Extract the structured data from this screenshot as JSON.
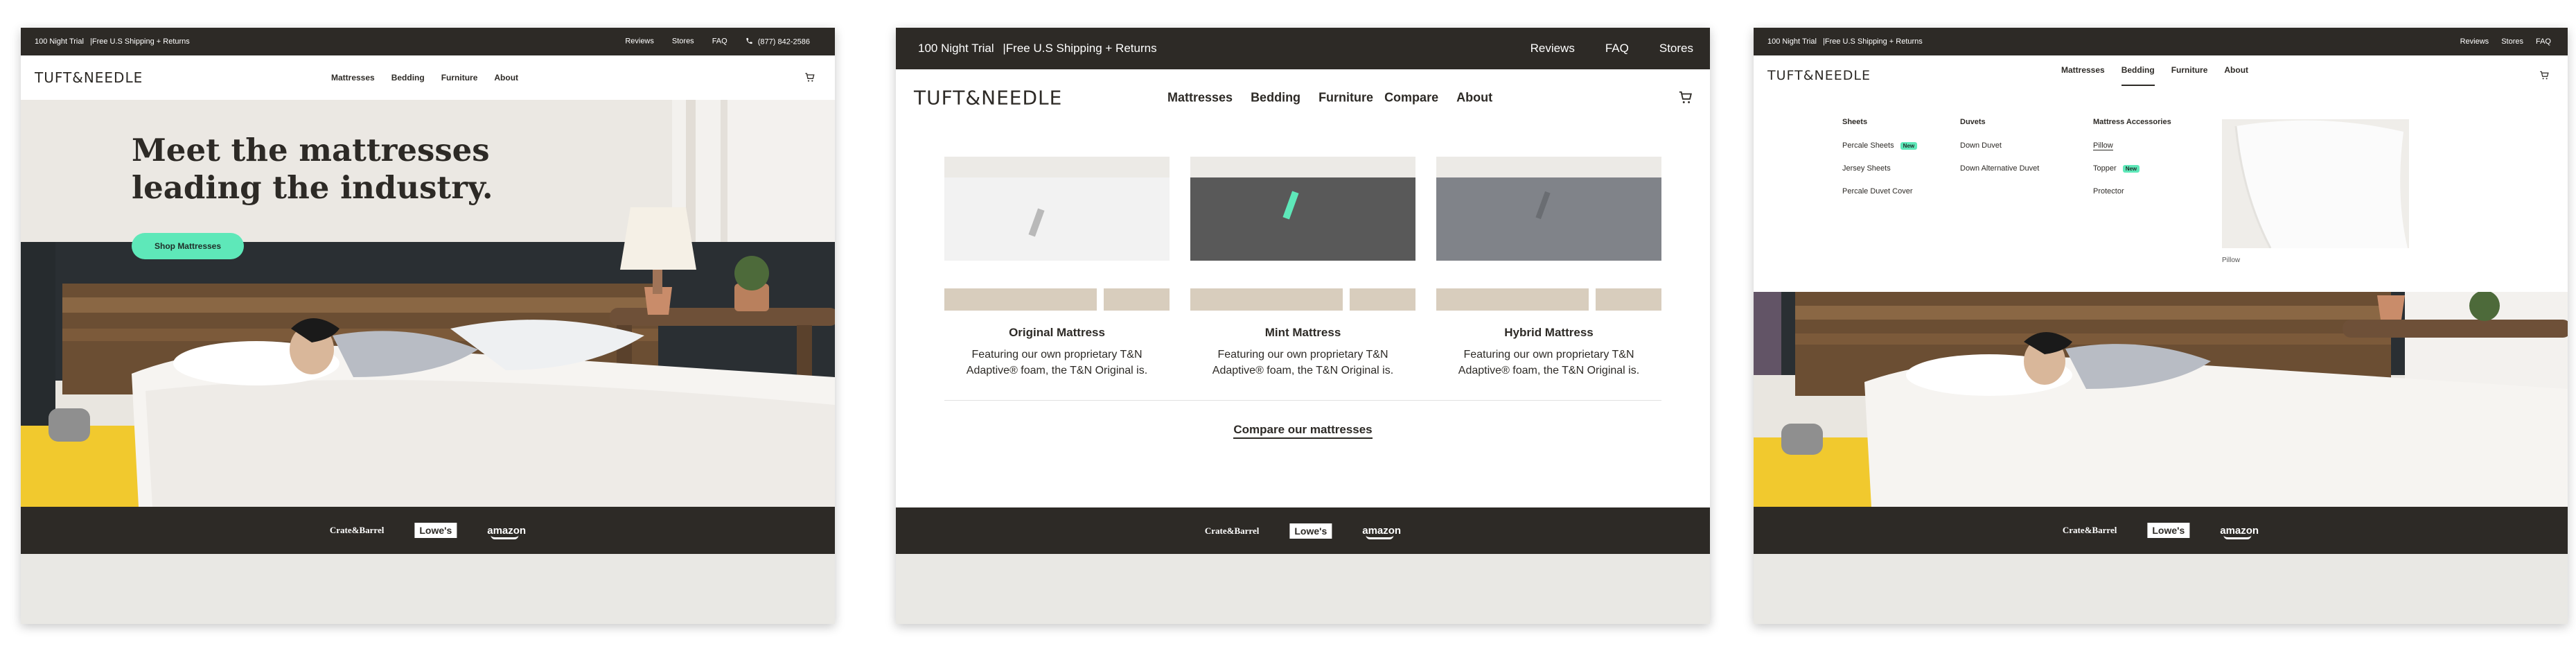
{
  "topbar": {
    "trial": "100 Night Trial",
    "shipping": "|Free U.S Shipping + Returns",
    "links": [
      "Reviews",
      "Stores",
      "FAQ"
    ],
    "phone": "(877) 842-2586",
    "links_alt": [
      "Reviews",
      "FAQ",
      "Stores"
    ],
    "links_right": [
      "Reviews",
      "Stores",
      "FAQ"
    ]
  },
  "nav": {
    "logo": "TUFT&NEEDLE",
    "items": [
      "Mattresses",
      "Bedding",
      "Furniture",
      "About"
    ],
    "items_with_compare": [
      "Mattresses",
      "Bedding",
      "Furniture",
      "Compare",
      "About"
    ]
  },
  "hero": {
    "headline_line1": "Meet the mattresses",
    "headline_line2": "leading the industry.",
    "cta": "Shop Mattresses"
  },
  "retailers": [
    "Crate&Barrel",
    "Lowe's",
    "amazon"
  ],
  "mattress_menu": {
    "cards": [
      {
        "title": "Original Mattress",
        "desc_line1": "Featuring our own proprietary T&N",
        "desc_line2": "Adaptive® foam, the T&N Original is."
      },
      {
        "title": "Mint Mattress",
        "desc_line1": "Featuring our own proprietary T&N",
        "desc_line2": "Adaptive® foam, the T&N Original is."
      },
      {
        "title": "Hybrid Mattress",
        "desc_line1": "Featuring our own proprietary T&N",
        "desc_line2": "Adaptive® foam, the T&N Original is."
      }
    ],
    "compare_link": "Compare our mattresses"
  },
  "bedding_menu": {
    "columns": [
      {
        "title": "Sheets",
        "links": [
          {
            "label": "Percale Sheets",
            "badge": "New"
          },
          {
            "label": "Jersey Sheets"
          },
          {
            "label": "Percale Duvet Cover"
          }
        ]
      },
      {
        "title": "Duvets",
        "links": [
          {
            "label": "Down Duvet"
          },
          {
            "label": "Down Alternative Duvet"
          }
        ]
      },
      {
        "title": "Mattress Accessories",
        "links": [
          {
            "label": "Pillow"
          },
          {
            "label": "Topper",
            "badge": "New"
          },
          {
            "label": "Protector"
          }
        ]
      }
    ],
    "preview_caption": "Pillow"
  },
  "colors": {
    "dark": "#2d2a26",
    "accent": "#5ee8b9",
    "page_bg": "#e9e8e4"
  },
  "icons": [
    "phone-icon",
    "cart-icon"
  ]
}
